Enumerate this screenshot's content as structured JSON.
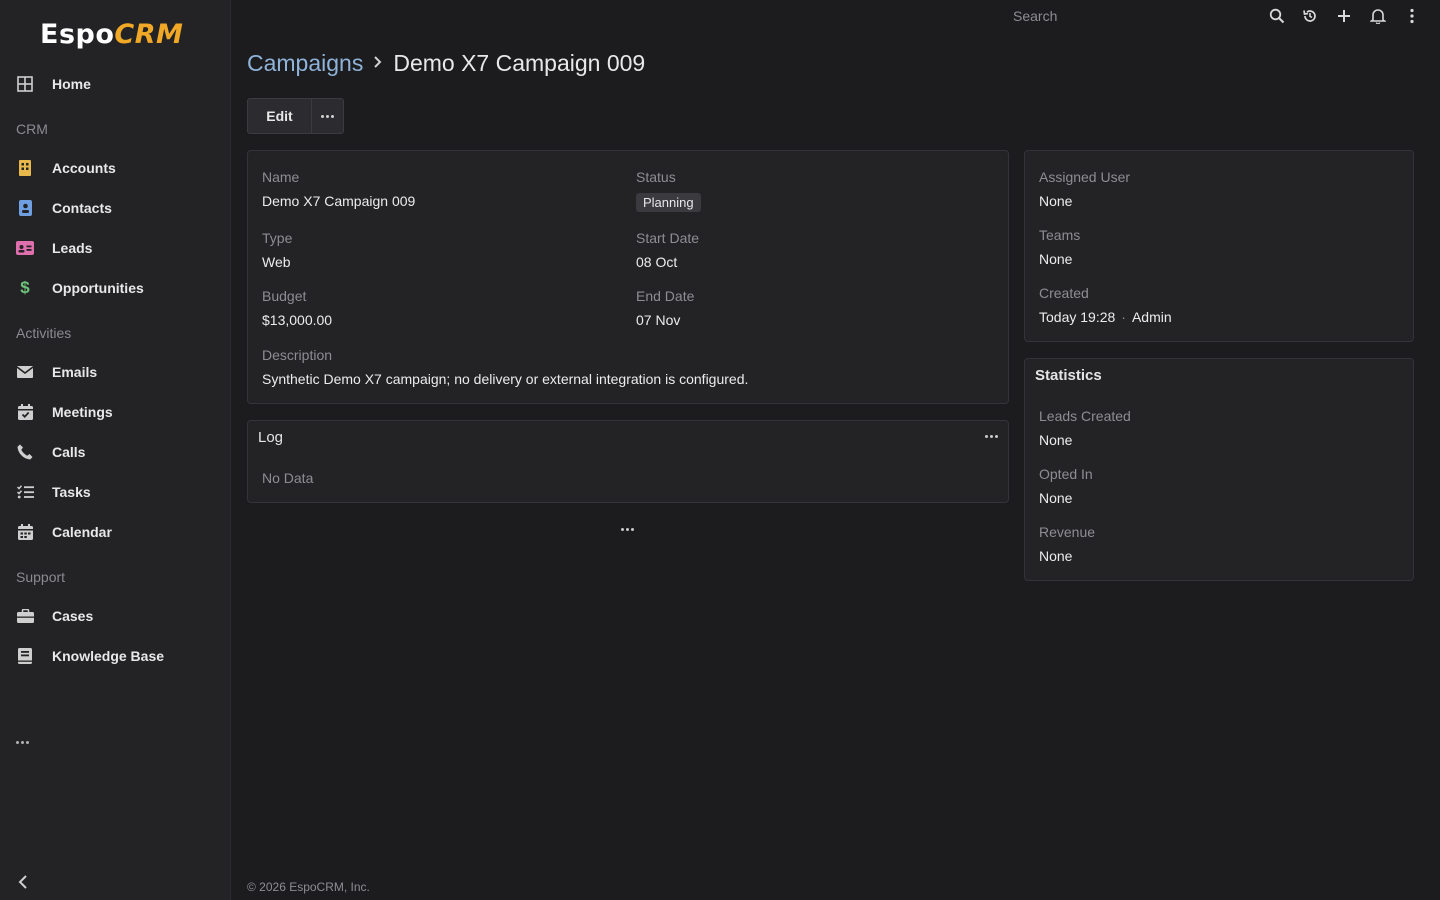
{
  "app": {
    "logo_main": "Espo",
    "logo_accent": "CRM"
  },
  "topbar": {
    "search_label": "Search"
  },
  "sidebar": {
    "home": "Home",
    "group_crm": "CRM",
    "accounts": "Accounts",
    "contacts": "Contacts",
    "leads": "Leads",
    "opportunities": "Opportunities",
    "group_activities": "Activities",
    "emails": "Emails",
    "meetings": "Meetings",
    "calls": "Calls",
    "tasks": "Tasks",
    "calendar": "Calendar",
    "group_support": "Support",
    "cases": "Cases",
    "knowledge_base": "Knowledge Base"
  },
  "header": {
    "breadcrumb_parent": "Campaigns",
    "breadcrumb_current": "Demo X7 Campaign 009",
    "edit_label": "Edit"
  },
  "details": {
    "name_label": "Name",
    "name_value": "Demo X7 Campaign 009",
    "status_label": "Status",
    "status_value": "Planning",
    "type_label": "Type",
    "type_value": "Web",
    "start_date_label": "Start Date",
    "start_date_value": "08 Oct",
    "budget_label": "Budget",
    "budget_value": "$13,000.00",
    "end_date_label": "End Date",
    "end_date_value": "07 Nov",
    "description_label": "Description",
    "description_value": "Synthetic Demo X7 campaign; no delivery or external integration is configured."
  },
  "log": {
    "title": "Log",
    "empty": "No Data"
  },
  "side_panel": {
    "assigned_user_label": "Assigned User",
    "assigned_user_value": "None",
    "teams_label": "Teams",
    "teams_value": "None",
    "created_label": "Created",
    "created_time": "Today 19:28",
    "created_separator": "·",
    "created_by": "Admin"
  },
  "statistics": {
    "title": "Statistics",
    "leads_created_label": "Leads Created",
    "leads_created_value": "None",
    "opted_in_label": "Opted In",
    "opted_in_value": "None",
    "revenue_label": "Revenue",
    "revenue_value": "None"
  },
  "footer": {
    "copyright": "© 2026 EspoCRM, Inc."
  },
  "colors": {
    "accent_logo": "#f0a826",
    "link": "#8fb3d9",
    "accounts_icon": "#e8b84a",
    "contacts_icon": "#6f9fe0",
    "leads_icon": "#e06fae",
    "opportunities_icon": "#6fc27a"
  }
}
